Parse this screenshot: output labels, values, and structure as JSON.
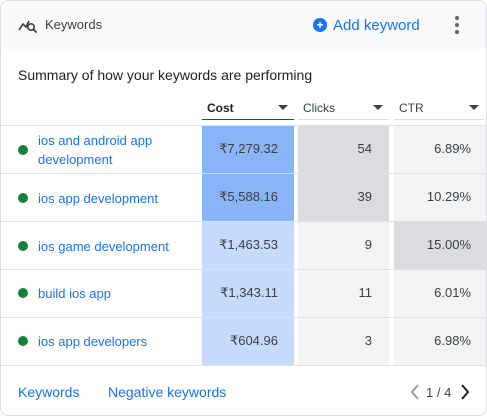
{
  "header": {
    "title": "Keywords",
    "add_label": "Add keyword",
    "icons": {
      "widget": "keyword-search-icon",
      "add": "add-circle-icon",
      "more": "more-vert-icon"
    }
  },
  "summary": "Summary of how your keywords are performing",
  "columns": [
    {
      "label": "Cost",
      "sorted": true
    },
    {
      "label": "Clicks",
      "sorted": false
    },
    {
      "label": "CTR",
      "sorted": false
    }
  ],
  "rows": [
    {
      "keyword": "ios and android app development",
      "cost": "₹7,279.32",
      "clicks": "54",
      "ctr": "6.89%",
      "status": "enabled"
    },
    {
      "keyword": "ios app development",
      "cost": "₹5,588.16",
      "clicks": "39",
      "ctr": "10.29%",
      "status": "enabled"
    },
    {
      "keyword": "ios game development",
      "cost": "₹1,463.53",
      "clicks": "9",
      "ctr": "15.00%",
      "status": "enabled"
    },
    {
      "keyword": "build ios app",
      "cost": "₹1,343.11",
      "clicks": "11",
      "ctr": "6.01%",
      "status": "enabled"
    },
    {
      "keyword": "ios app developers",
      "cost": "₹604.96",
      "clicks": "3",
      "ctr": "6.98%",
      "status": "enabled"
    }
  ],
  "heat_colors": {
    "cost": [
      "#8ab4f8",
      "#8ab4f8",
      "#c6dafc",
      "#c6dafc",
      "#c6dafc"
    ],
    "clicks": [
      "#dadce0",
      "#dadce0",
      "#f1f3f4",
      "#f1f3f4",
      "#f1f3f4"
    ],
    "ctr": [
      "#f1f3f4",
      "#f1f3f4",
      "#dadce0",
      "#f1f3f4",
      "#f1f3f4"
    ]
  },
  "footer": {
    "keywords_link": "Keywords",
    "negative_link": "Negative keywords",
    "pagination": "1 / 4"
  },
  "colors": {
    "accent": "#1a73e8",
    "status_green": "#188038",
    "header_bg": "#f8f9fa"
  }
}
